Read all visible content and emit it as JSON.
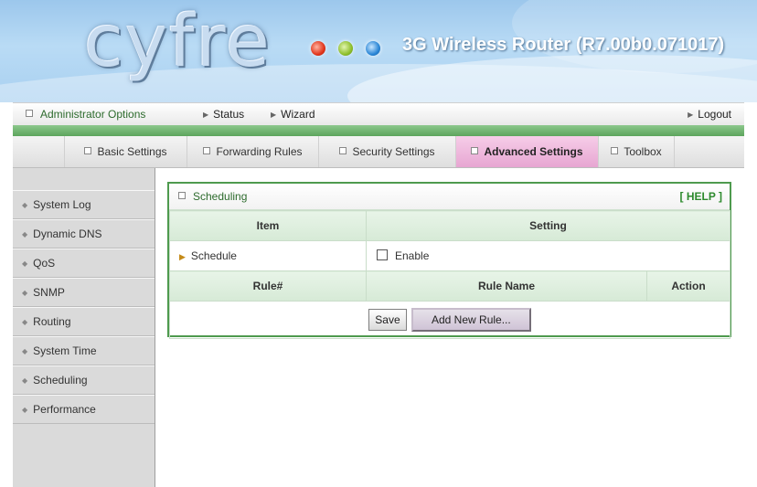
{
  "header": {
    "brand": "cyfre",
    "product_title": "3G Wireless Router (R7.00b0.071017)"
  },
  "topnav": {
    "admin_options": "Administrator Options",
    "status": "Status",
    "wizard": "Wizard",
    "logout": "Logout"
  },
  "tabs": [
    {
      "label": "Basic Settings"
    },
    {
      "label": "Forwarding Rules"
    },
    {
      "label": "Security Settings"
    },
    {
      "label": "Advanced Settings",
      "active": true
    },
    {
      "label": "Toolbox"
    }
  ],
  "sidebar": {
    "items": [
      {
        "label": "System Log"
      },
      {
        "label": "Dynamic DNS"
      },
      {
        "label": "QoS"
      },
      {
        "label": "SNMP"
      },
      {
        "label": "Routing"
      },
      {
        "label": "System Time"
      },
      {
        "label": "Scheduling"
      },
      {
        "label": "Performance"
      }
    ]
  },
  "panel": {
    "title": "Scheduling",
    "help": "[ HELP ]",
    "headers": {
      "item": "Item",
      "setting": "Setting"
    },
    "schedule_label": "Schedule",
    "enable_label": "Enable",
    "enable_checked": false,
    "rule_headers": {
      "rule_num": "Rule#",
      "rule_name": "Rule Name",
      "action": "Action"
    },
    "save_button": "Save",
    "add_rule_button": "Add New Rule..."
  },
  "colors": {
    "accent_green": "#4e9a4e",
    "active_tab": "#e7a6d2",
    "header_sky": "#a9d0f0"
  }
}
